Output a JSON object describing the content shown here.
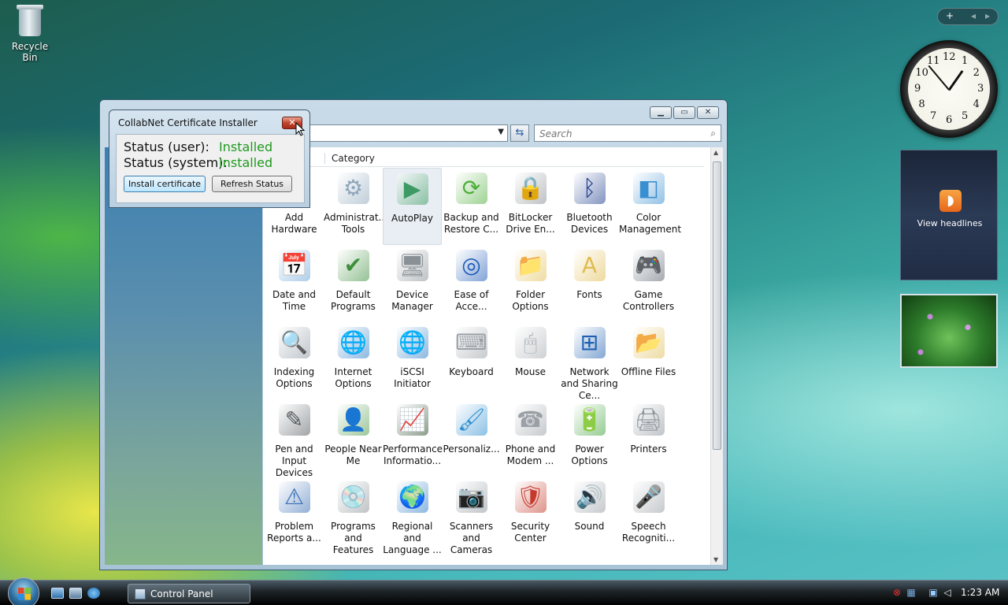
{
  "desktop": {
    "recycle_bin_label": "Recycle Bin"
  },
  "control_panel": {
    "search_placeholder": "Search",
    "column_header": "Category",
    "items": [
      {
        "label": "Add Hardware",
        "icon": "add-hardware-icon",
        "color": "#5a7fa8",
        "glyph": "🖨"
      },
      {
        "label": "Administrat... Tools",
        "icon": "administrative-tools-icon",
        "color": "#8ea6bb",
        "glyph": "⚙"
      },
      {
        "label": "AutoPlay",
        "icon": "autoplay-icon",
        "color": "#3c9a62",
        "glyph": "▶"
      },
      {
        "label": "Backup and Restore C...",
        "icon": "backup-icon",
        "color": "#4fae3c",
        "glyph": "⟳"
      },
      {
        "label": "BitLocker Drive En...",
        "icon": "bitlocker-icon",
        "color": "#8a8f95",
        "glyph": "🔒"
      },
      {
        "label": "Bluetooth Devices",
        "icon": "bluetooth-icon",
        "color": "#1c3c8c",
        "glyph": "ᛒ"
      },
      {
        "label": "Color Management",
        "icon": "color-management-icon",
        "color": "#3a8fd0",
        "glyph": "◧"
      },
      {
        "label": "Date and Time",
        "icon": "date-time-icon",
        "color": "#6ea6d8",
        "glyph": "📅"
      },
      {
        "label": "Default Programs",
        "icon": "default-programs-icon",
        "color": "#3e8f3c",
        "glyph": "✔"
      },
      {
        "label": "Device Manager",
        "icon": "device-manager-icon",
        "color": "#8a9196",
        "glyph": "🖥"
      },
      {
        "label": "Ease of Acce...",
        "icon": "ease-of-access-icon",
        "color": "#1b58b5",
        "glyph": "◎"
      },
      {
        "label": "Folder Options",
        "icon": "folder-options-icon",
        "color": "#e3c15a",
        "glyph": "📁"
      },
      {
        "label": "Fonts",
        "icon": "fonts-icon",
        "color": "#e0bc4f",
        "glyph": "A"
      },
      {
        "label": "Game Controllers",
        "icon": "game-controllers-icon",
        "color": "#5b6470",
        "glyph": "🎮"
      },
      {
        "label": "Indexing Options",
        "icon": "indexing-options-icon",
        "color": "#8c98a3",
        "glyph": "🔍"
      },
      {
        "label": "Internet Options",
        "icon": "internet-options-icon",
        "color": "#2f7fc7",
        "glyph": "🌐"
      },
      {
        "label": "iSCSI Initiator",
        "icon": "iscsi-initiator-icon",
        "color": "#2f7fc7",
        "glyph": "🌐"
      },
      {
        "label": "Keyboard",
        "icon": "keyboard-icon",
        "color": "#9aa0a6",
        "glyph": "⌨"
      },
      {
        "label": "Mouse",
        "icon": "mouse-icon",
        "color": "#a7adb3",
        "glyph": "🖱"
      },
      {
        "label": "Network and Sharing Ce...",
        "icon": "network-sharing-icon",
        "color": "#2060b0",
        "glyph": "⊞"
      },
      {
        "label": "Offline Files",
        "icon": "offline-files-icon",
        "color": "#e0c05a",
        "glyph": "📂"
      },
      {
        "label": "Pen and Input Devices",
        "icon": "pen-input-icon",
        "color": "#555b61",
        "glyph": "✎"
      },
      {
        "label": "People Near Me",
        "icon": "people-near-me-icon",
        "color": "#4f9a4a",
        "glyph": "👤"
      },
      {
        "label": "Performance Informatio...",
        "icon": "performance-icon",
        "color": "#2f4d2f",
        "glyph": "📈"
      },
      {
        "label": "Personaliz...",
        "icon": "personalization-icon",
        "color": "#2f8fd0",
        "glyph": "🖌"
      },
      {
        "label": "Phone and Modem ...",
        "icon": "phone-modem-icon",
        "color": "#9aa0a6",
        "glyph": "☎"
      },
      {
        "label": "Power Options",
        "icon": "power-options-icon",
        "color": "#3fa33a",
        "glyph": "🔋"
      },
      {
        "label": "Printers",
        "icon": "printers-icon",
        "color": "#8e959c",
        "glyph": "🖨"
      },
      {
        "label": "Problem Reports a...",
        "icon": "problem-reports-icon",
        "color": "#3b6fb5",
        "glyph": "⚠"
      },
      {
        "label": "Programs and Features",
        "icon": "programs-features-icon",
        "color": "#8d949a",
        "glyph": "💿"
      },
      {
        "label": "Regional and Language ...",
        "icon": "regional-language-icon",
        "color": "#2f7fc7",
        "glyph": "🌍"
      },
      {
        "label": "Scanners and Cameras",
        "icon": "scanners-cameras-icon",
        "color": "#8e959c",
        "glyph": "📷"
      },
      {
        "label": "Security Center",
        "icon": "security-center-icon",
        "color": "#c43b2c",
        "glyph": "🛡"
      },
      {
        "label": "Sound",
        "icon": "sound-icon",
        "color": "#9aa0a6",
        "glyph": "🔊"
      },
      {
        "label": "Speech Recogniti...",
        "icon": "speech-recognition-icon",
        "color": "#9aa0a6",
        "glyph": "🎤"
      }
    ]
  },
  "dialog": {
    "title": "CollabNet Certificate Installer",
    "status_user_label": "Status (user):",
    "status_user_value": "Installed",
    "status_system_label": "Status (system):",
    "status_system_value": "Installed",
    "install_button": "Install certificate",
    "refresh_button": "Refresh Status",
    "close_glyph": "✕"
  },
  "sidebar": {
    "add_glyph": "+",
    "prev_glyph": "◂",
    "next_glyph": "▸",
    "feed_label": "View headlines",
    "rss_glyph": "◗"
  },
  "clock": {
    "numbers": [
      "12",
      "1",
      "2",
      "3",
      "4",
      "5",
      "6",
      "7",
      "8",
      "9",
      "10",
      "11"
    ]
  },
  "taskbar": {
    "task_label": "Control Panel",
    "time": "1:23 AM"
  }
}
